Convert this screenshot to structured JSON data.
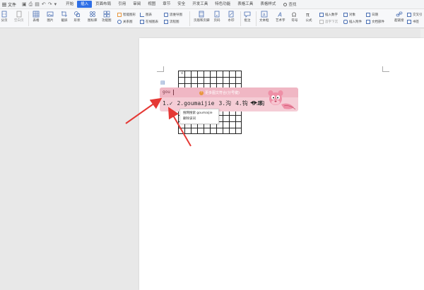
{
  "menubar": {
    "file_label": "文件",
    "tabs": [
      {
        "label": "开始"
      },
      {
        "label": "插入",
        "active": true
      },
      {
        "label": "页面布局"
      },
      {
        "label": "引用"
      },
      {
        "label": "审阅"
      },
      {
        "label": "视图"
      },
      {
        "label": "章节"
      },
      {
        "label": "安全"
      },
      {
        "label": "开发工具"
      },
      {
        "label": "特色功能"
      },
      {
        "label": "表格工具"
      },
      {
        "label": "表格样式"
      }
    ],
    "search_label": "查找"
  },
  "ribbon": {
    "page_label": "分页",
    "cover_label": "空白页",
    "table_label": "表格",
    "picture_label": "图片",
    "screenshot_label": "截屏",
    "shape_label": "形状",
    "iconlib_label": "图标库",
    "funcchart_label": "功能图",
    "smartart_label": "智能图形",
    "relation_label": "关系图",
    "chart_label": "图表",
    "online_chart_label": "在线图表",
    "mindmap_label": "思维导图",
    "flowchart_label": "流程图",
    "header_footer_label": "页眉和页脚",
    "page_number_label": "页码",
    "watermark_label": "水印",
    "comment_label": "批注",
    "textbox_label": "文本框",
    "wordart_label": "艺术字",
    "symbol_label": "符号",
    "formula_label": "公式",
    "insert_number_label": "插入数字",
    "object_label": "对象",
    "dropcap_label": "首字下沉",
    "attachment_label": "插入附件",
    "date_label": "日期",
    "docpart_label": "文档部件",
    "hyperlink_label": "超链接",
    "cross_ref_label": "交叉引",
    "bookmark_label": "书签"
  },
  "document": {
    "grid_mark": "√"
  },
  "ime": {
    "composition": "gou",
    "tip": "更多图文符合(分号键)",
    "candidates": [
      {
        "label": "1.✓"
      },
      {
        "label": "2.goumaijie"
      },
      {
        "label": "3.沟"
      },
      {
        "label": "4.钩"
      },
      {
        "label": "5.构"
      }
    ],
    "nav_prev": "◀",
    "nav_next": "▶"
  },
  "context_menu": {
    "items": [
      {
        "label": "搜网搜索 goumaijie"
      },
      {
        "label": "删除该词"
      }
    ]
  },
  "colors": {
    "active_tab": "#2d6ee6",
    "ime_bg": "#f5cdd6",
    "arrow": "#e53935"
  }
}
